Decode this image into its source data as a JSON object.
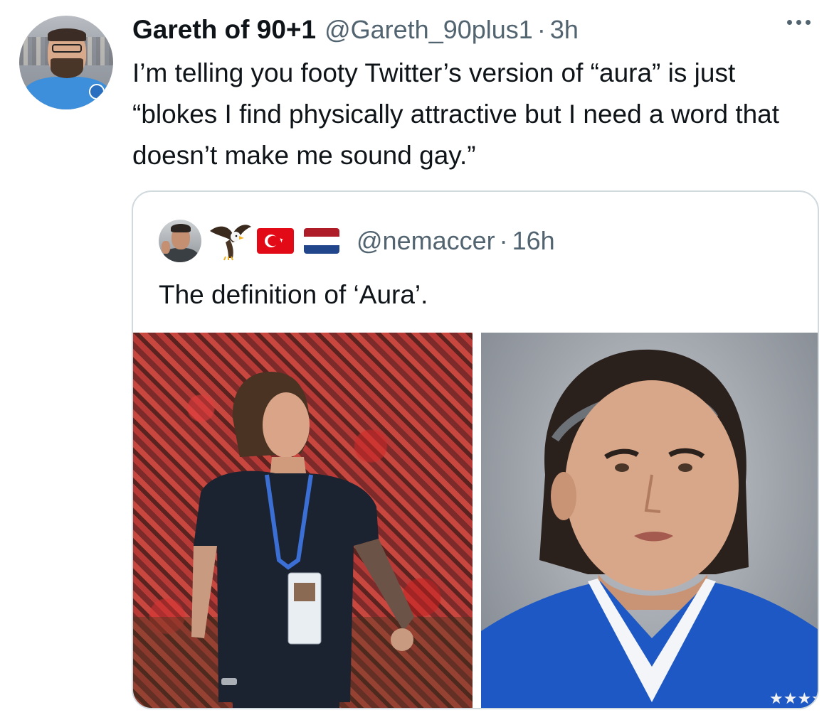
{
  "tweet": {
    "author": {
      "display_name": "Gareth of 90+1",
      "handle": "@Gareth_90plus1",
      "separator": "·",
      "time": "3h"
    },
    "more_icon": "more-horizontal-icon",
    "text": "I’m telling you footy Twitter’s version of “aura” is just “blokes I find physically attractive but I need a word that doesn’t make me sound gay.”"
  },
  "quote": {
    "author": {
      "handle": "@nemaccer",
      "separator": "·",
      "time": "16h",
      "name_emojis": [
        "eagle-emoji",
        "turkey-flag-emoji",
        "netherlands-flag-emoji"
      ]
    },
    "text": "The definition of ‘Aura’.",
    "media": [
      "player-in-stadium-photo",
      "player-headband-portrait-photo"
    ]
  },
  "colors": {
    "text_primary": "#0f1419",
    "text_secondary": "#536471",
    "border": "#cfd9de"
  }
}
